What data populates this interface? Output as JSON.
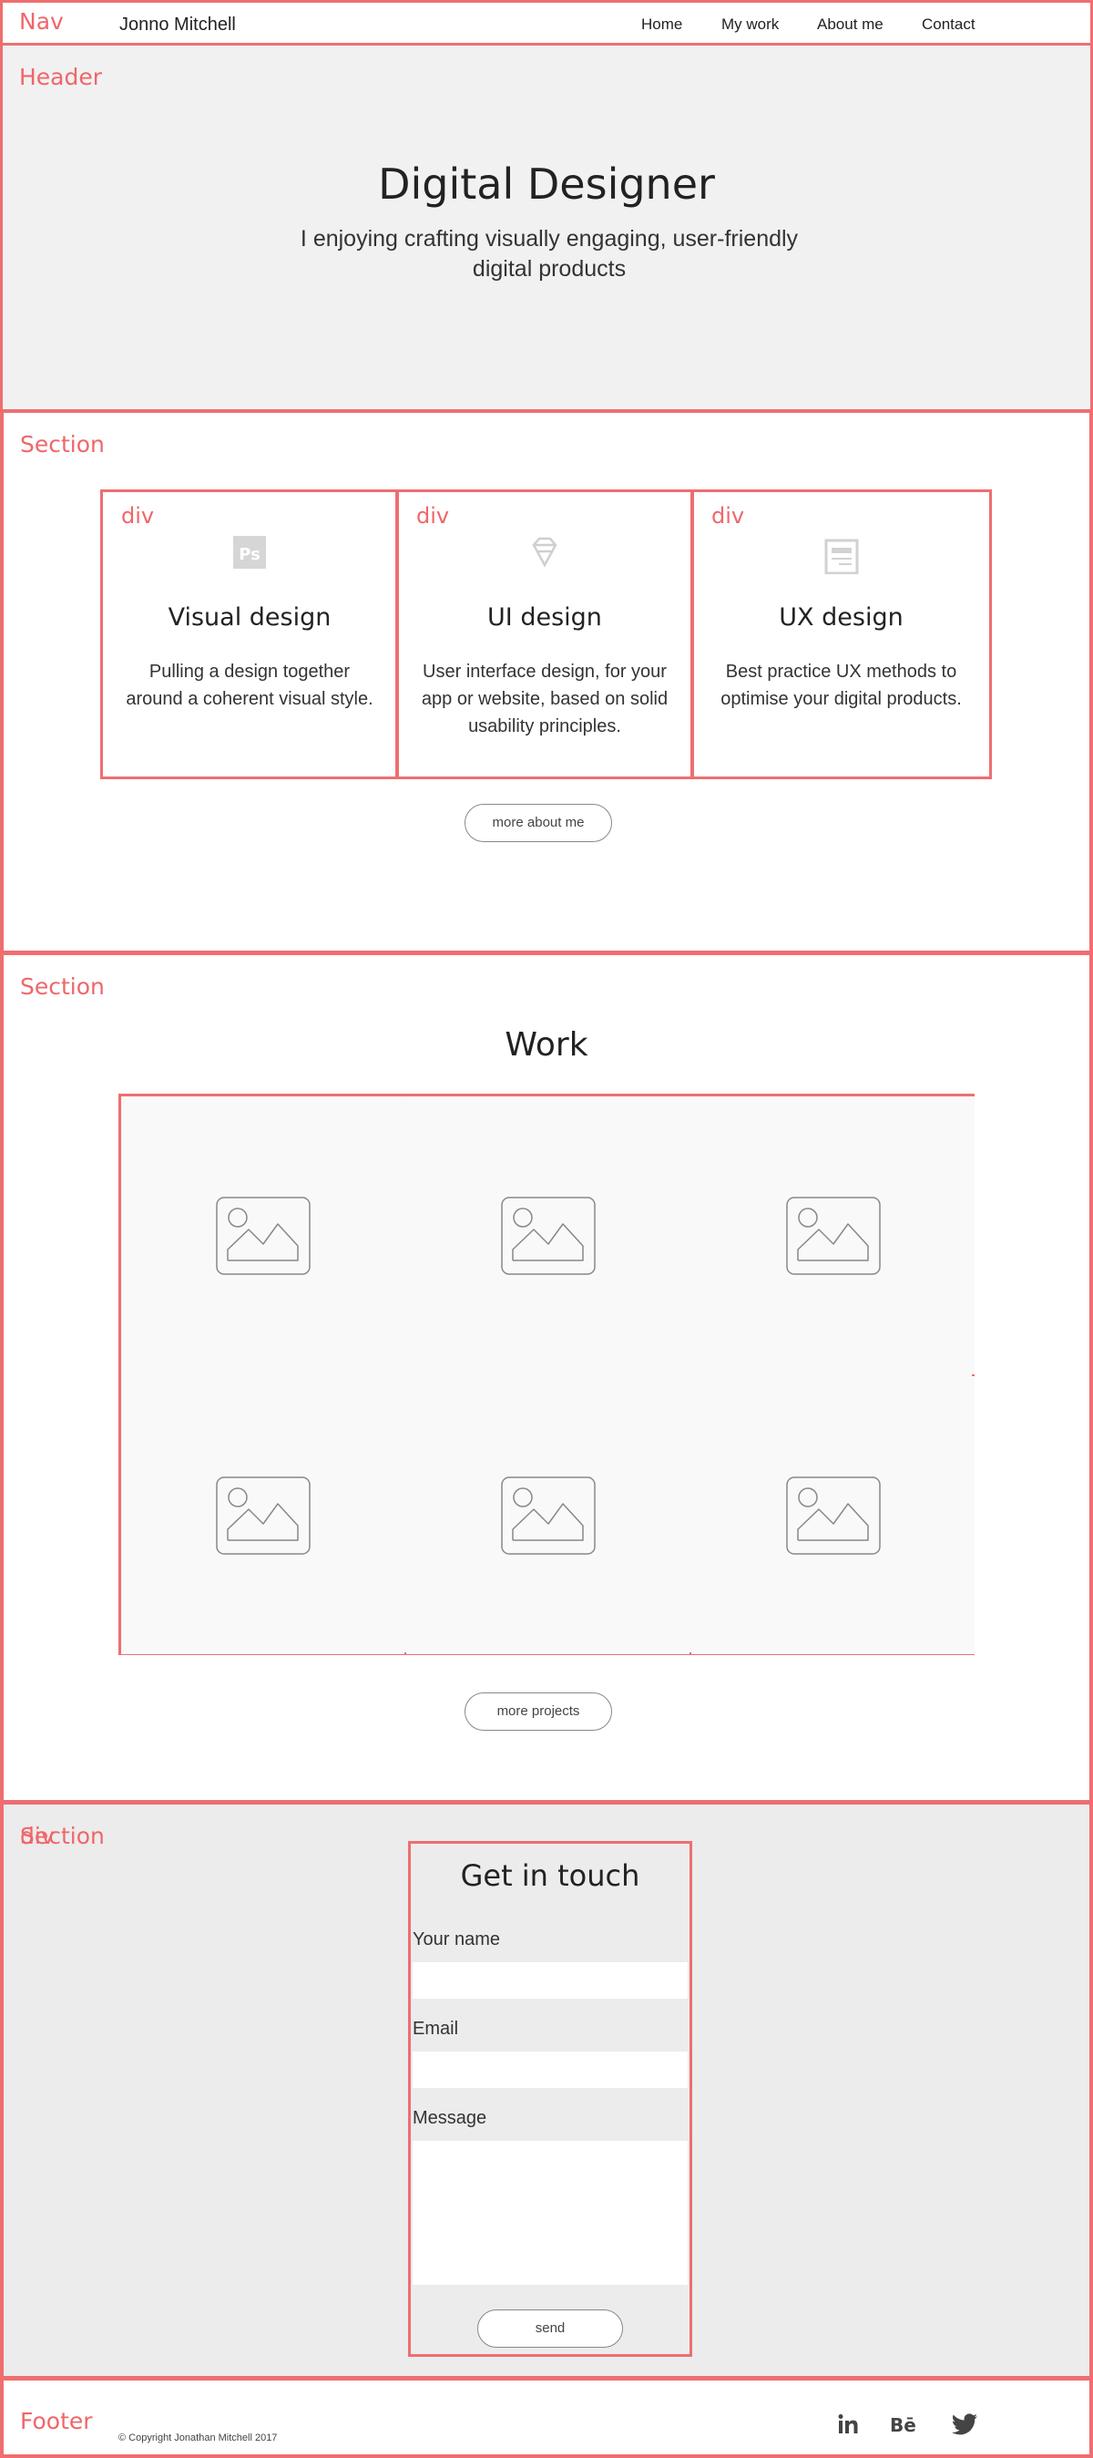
{
  "annotations": {
    "nav": "Nav",
    "header": "Header",
    "section": "Section",
    "div": "div",
    "footer": "Footer"
  },
  "nav": {
    "brand": "Jonno Mitchell",
    "links": [
      "Home",
      "My work",
      "About me",
      "Contact"
    ]
  },
  "header": {
    "title": "Digital Designer",
    "subtitle": "I enjoying crafting visually engaging, user-friendly digital products"
  },
  "services": {
    "cards": [
      {
        "icon": "photoshop-icon",
        "title": "Visual design",
        "text": "Pulling a design together around a coherent visual style."
      },
      {
        "icon": "sketch-diamond-icon",
        "title": "UI design",
        "text": "User interface design, for your app or website, based on solid usability principles."
      },
      {
        "icon": "wireframe-document-icon",
        "title": "UX design",
        "text": "Best practice UX methods to optimise your digital products."
      }
    ],
    "button": "more about me"
  },
  "work": {
    "title": "Work",
    "items": [
      "image-placeholder-icon",
      "image-placeholder-icon",
      "image-placeholder-icon",
      "image-placeholder-icon",
      "image-placeholder-icon",
      "image-placeholder-icon"
    ],
    "button": "more projects"
  },
  "contact": {
    "title": "Get in touch",
    "fields": [
      {
        "label": "Your name",
        "value": ""
      },
      {
        "label": "Email",
        "value": ""
      },
      {
        "label": "Message",
        "value": ""
      }
    ],
    "button": "send"
  },
  "footer": {
    "copyright": "© Copyright Jonathan Mitchell 2017",
    "social": [
      "linkedin-icon",
      "behance-icon",
      "twitter-icon"
    ]
  },
  "colors": {
    "annotation": "#ef6e70",
    "header_bg": "#f1f1f1",
    "contact_bg": "#ececec"
  }
}
